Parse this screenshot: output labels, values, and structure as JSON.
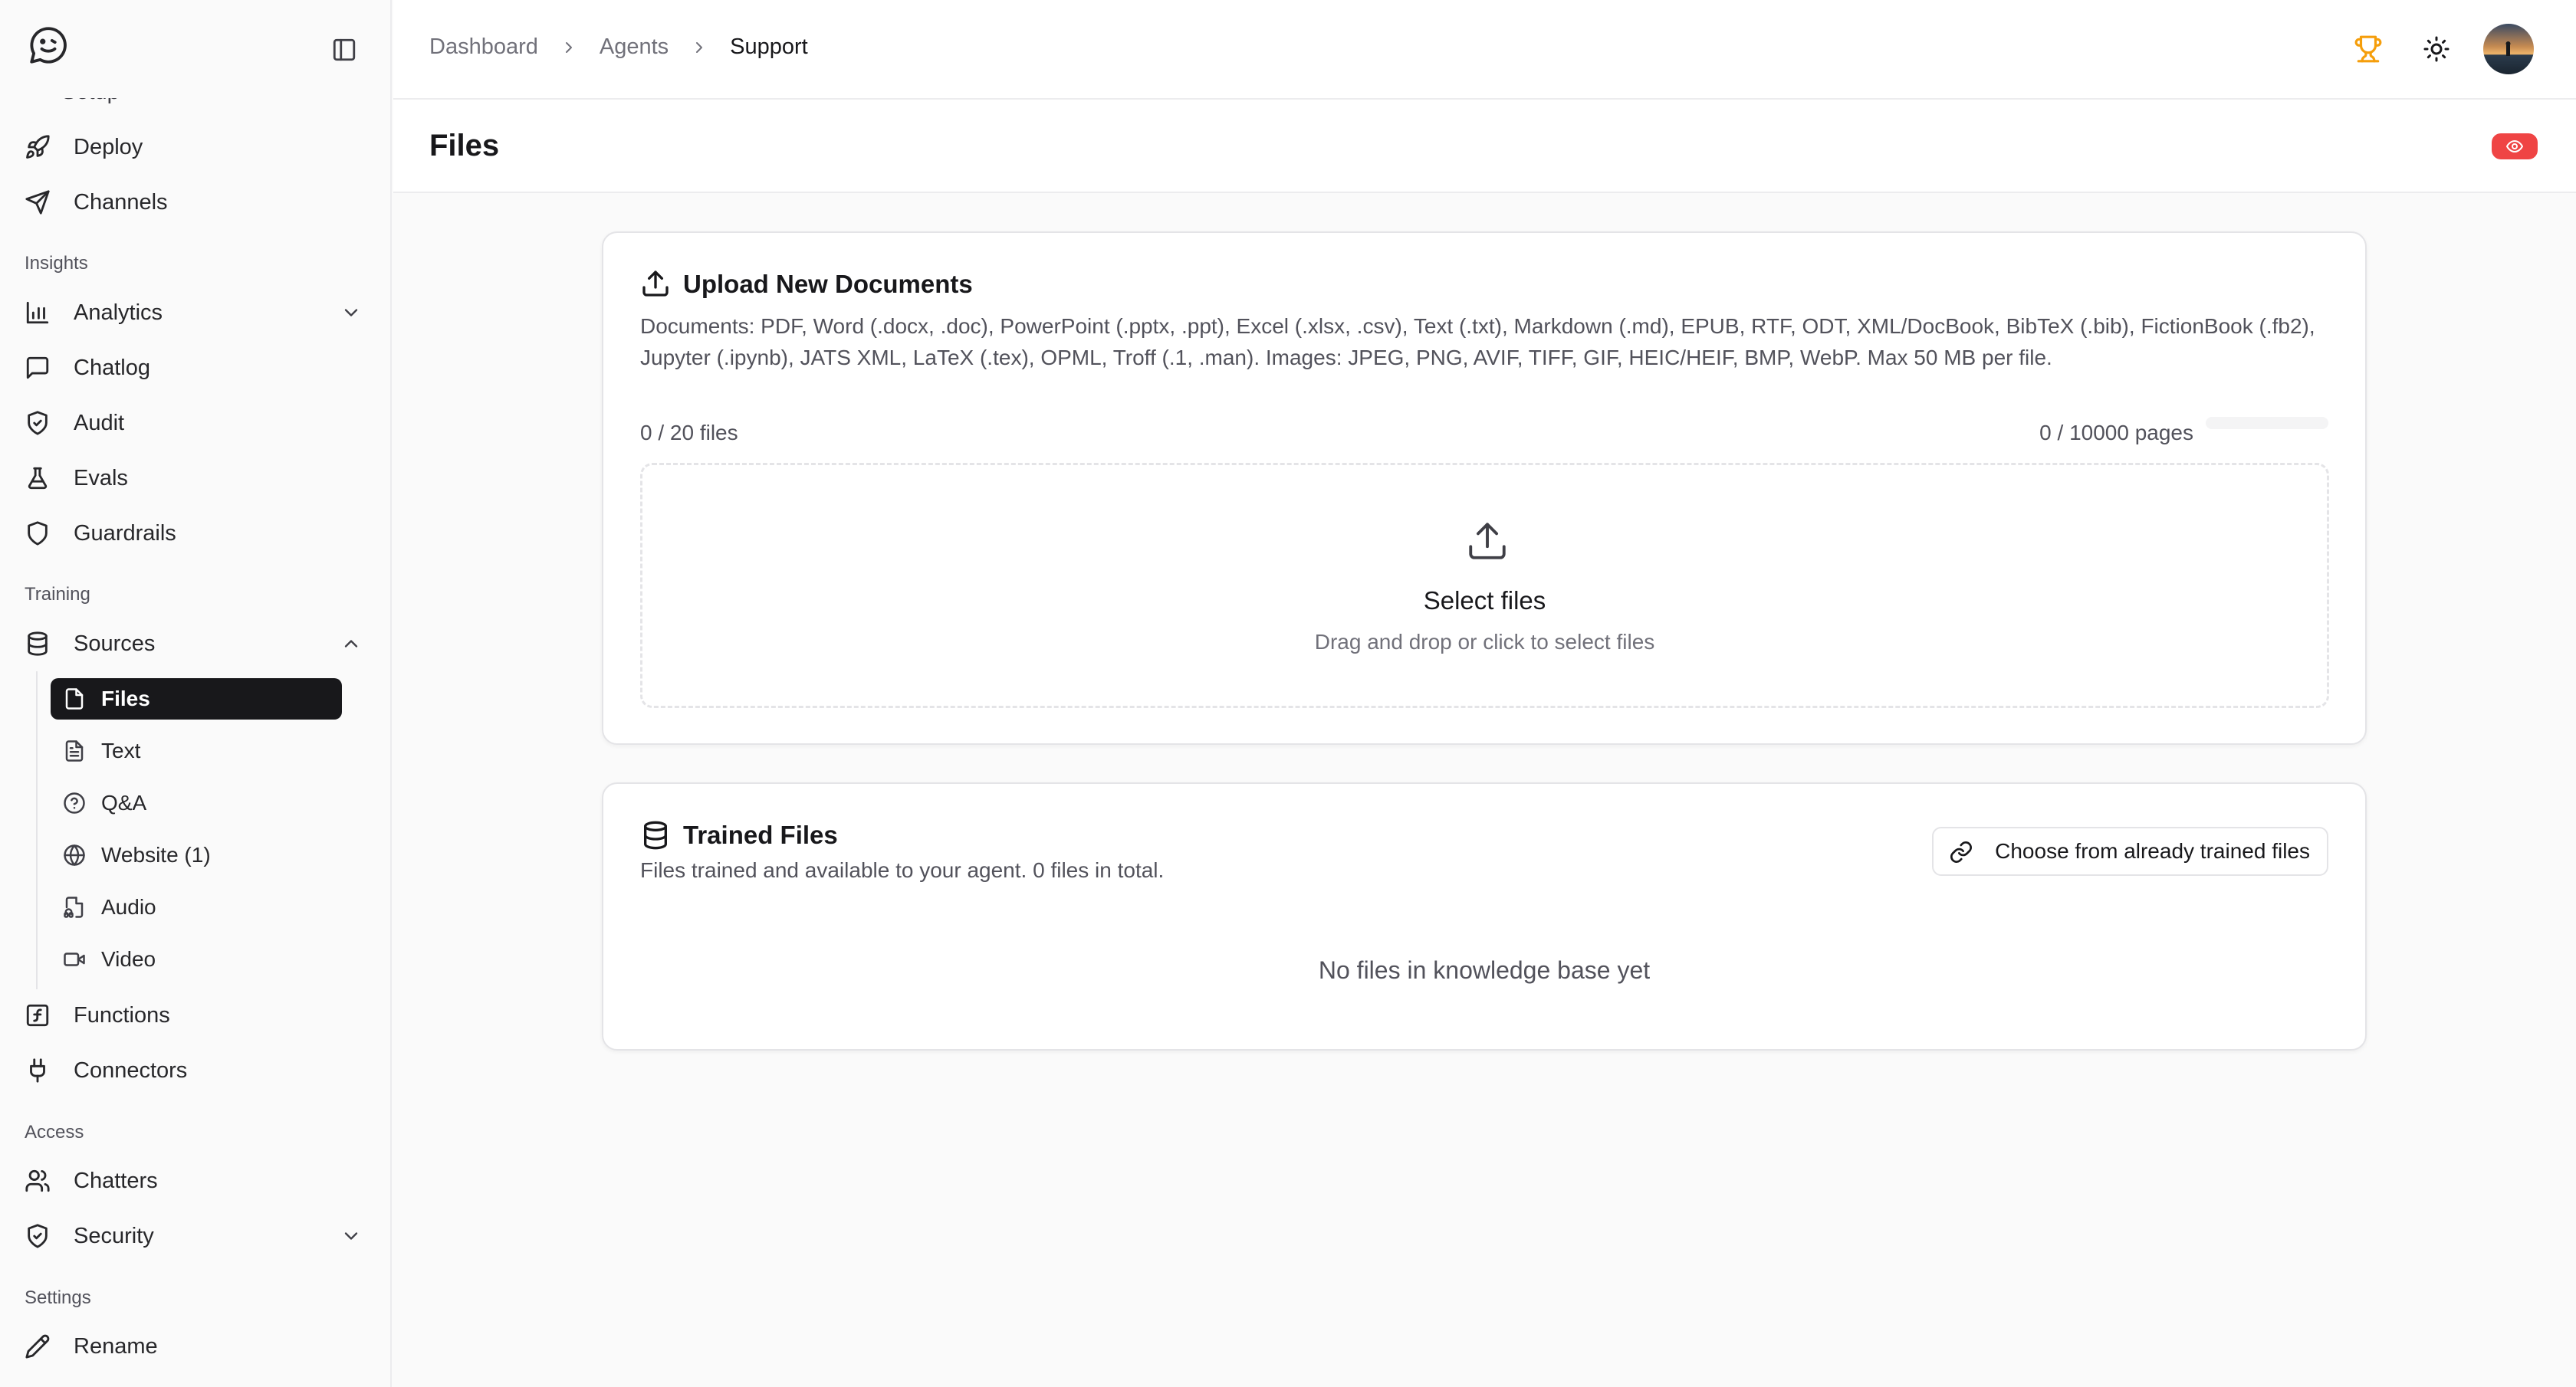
{
  "sidebar": {
    "cut_item": "Setup",
    "items": {
      "deploy": "Deploy",
      "channels": "Channels",
      "analytics": "Analytics",
      "chatlog": "Chatlog",
      "audit": "Audit",
      "evals": "Evals",
      "guardrails": "Guardrails",
      "sources": "Sources",
      "functions": "Functions",
      "connectors": "Connectors",
      "chatters": "Chatters",
      "security": "Security",
      "rename": "Rename"
    },
    "sections": {
      "insights": "Insights",
      "training": "Training",
      "access": "Access",
      "settings": "Settings"
    },
    "sources_sub": {
      "files": "Files",
      "text": "Text",
      "qa": "Q&A",
      "website": "Website (1)",
      "audio": "Audio",
      "video": "Video"
    }
  },
  "breadcrumb": {
    "items": [
      "Dashboard",
      "Agents",
      "Support"
    ]
  },
  "page": {
    "title": "Files"
  },
  "upload": {
    "title": "Upload New Documents",
    "description": "Documents: PDF, Word (.docx, .doc), PowerPoint (.pptx, .ppt), Excel (.xlsx, .csv), Text (.txt), Markdown (.md), EPUB, RTF, ODT, XML/DocBook, BibTeX (.bib), FictionBook (.fb2), Jupyter (.ipynb), JATS XML, LaTeX (.tex), OPML, Troff (.1, .man). Images: JPEG, PNG, AVIF, TIFF, GIF, HEIC/HEIF, BMP, WebP. Max 50 MB per file.",
    "files_count": "0 / 20 files",
    "pages_count": "0 / 10000 pages",
    "pages_progress": 0,
    "dropzone_title": "Select files",
    "dropzone_subtitle": "Drag and drop or click to select files"
  },
  "trained": {
    "title": "Trained Files",
    "subtitle": "Files trained and available to your agent. 0 files in total.",
    "choose_button": "Choose from already trained files",
    "empty_text": "No files in knowledge base yet"
  },
  "colors": {
    "active_bg": "#18181b",
    "trophy": "#f59e0b",
    "badge_red": "#ef4444"
  }
}
